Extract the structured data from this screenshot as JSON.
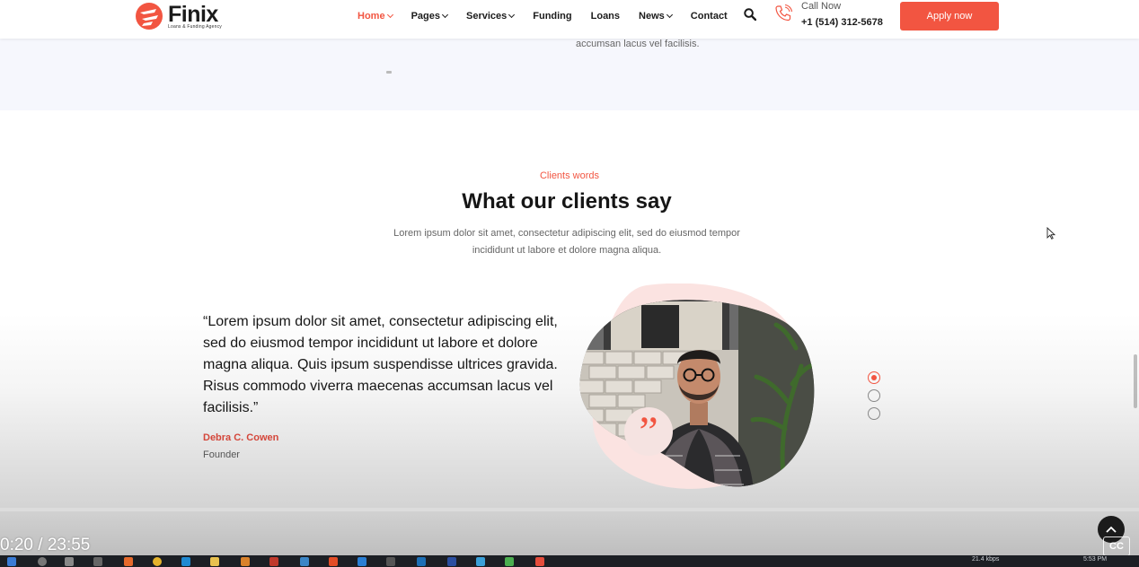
{
  "header": {
    "logo_name": "Finix",
    "logo_tagline": "Loans & Funding Agency",
    "nav": [
      {
        "label": "Home",
        "active": true,
        "dropdown": true
      },
      {
        "label": "Pages",
        "active": false,
        "dropdown": true
      },
      {
        "label": "Services",
        "active": false,
        "dropdown": true
      },
      {
        "label": "Funding",
        "active": false,
        "dropdown": false
      },
      {
        "label": "Loans",
        "active": false,
        "dropdown": false
      },
      {
        "label": "News",
        "active": false,
        "dropdown": true
      },
      {
        "label": "Contact",
        "active": false,
        "dropdown": false
      }
    ],
    "call_label": "Call Now",
    "call_number": "+1 (514) 312-5678",
    "apply_label": "Apply now"
  },
  "previous_section": {
    "trailing_text": "accumsan lacus vel facilisis."
  },
  "testimonials": {
    "eyebrow": "Clients words",
    "title": "What our clients say",
    "subtitle": "Lorem ipsum dolor sit amet, consectetur adipiscing elit, sed do eiusmod tempor incididunt ut labore et dolore magna aliqua.",
    "quote": "“Lorem ipsum dolor sit amet, consectetur adipiscing elit, sed do eiusmod tempor incididunt ut labore et dolore magna aliqua. Quis ipsum suspendisse ultrices gravida. Risus commodo viverra maecenas accumsan lacus vel facilisis.”",
    "author_name": "Debra C. Cowen",
    "author_role": "Founder",
    "slide_count": 3,
    "active_slide": 1
  },
  "video_overlay": {
    "time": "0:20 / 23:55",
    "cc_label": "CC"
  },
  "taskbar": {
    "network_speed": "21.4 kbps",
    "clock": "5:53 PM"
  },
  "colors": {
    "accent": "#f25541",
    "accent_dark": "#d4463a",
    "heading": "#161616",
    "muted": "#666666",
    "section_bg": "#f6f7fd",
    "blob_pink": "#fbe3e1"
  },
  "icons": [
    "logo-mark",
    "search-icon",
    "phone-icon",
    "quote-icon",
    "chevron-up-icon",
    "cursor-icon"
  ]
}
